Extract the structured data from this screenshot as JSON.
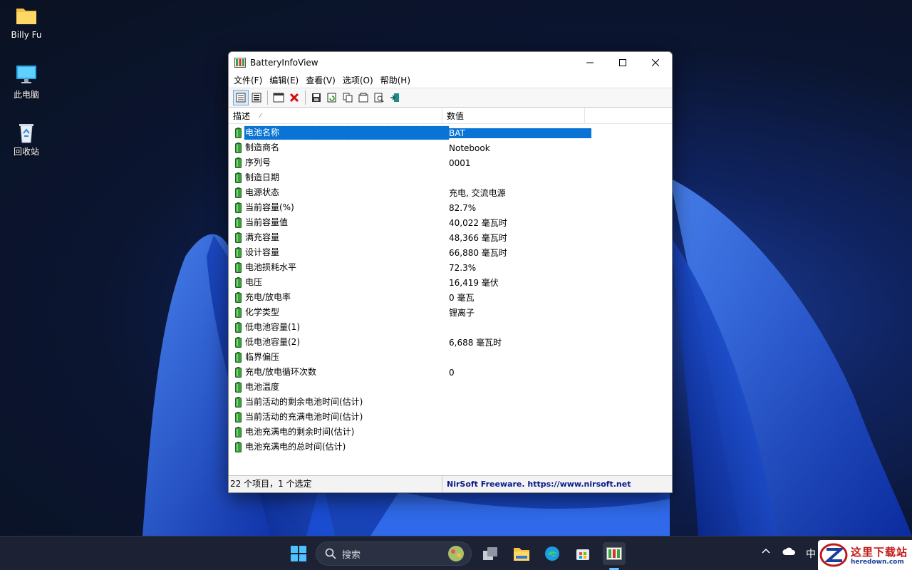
{
  "desktop": {
    "icons": [
      {
        "label": "Billy Fu",
        "icon": "folder-icon"
      },
      {
        "label": "此电脑",
        "icon": "computer-icon"
      },
      {
        "label": "回收站",
        "icon": "recycle-bin-icon"
      }
    ]
  },
  "window": {
    "title": "BatteryInfoView",
    "menu": [
      "文件(F)",
      "编辑(E)",
      "查看(V)",
      "选项(O)",
      "帮助(H)"
    ],
    "columns": {
      "description": "描述",
      "value": "数值"
    },
    "rows": [
      {
        "desc": "电池名称",
        "val": "BAT",
        "selected": true
      },
      {
        "desc": "制造商名",
        "val": "Notebook"
      },
      {
        "desc": "序列号",
        "val": "0001"
      },
      {
        "desc": "制造日期",
        "val": ""
      },
      {
        "desc": "电源状态",
        "val": "充电, 交流电源"
      },
      {
        "desc": "当前容量(%)",
        "val": "82.7%"
      },
      {
        "desc": "当前容量值",
        "val": "40,022 毫瓦时"
      },
      {
        "desc": "满充容量",
        "val": "48,366 毫瓦时"
      },
      {
        "desc": "设计容量",
        "val": "66,880 毫瓦时"
      },
      {
        "desc": "电池损耗水平",
        "val": "72.3%"
      },
      {
        "desc": "电压",
        "val": "16,419 毫伏"
      },
      {
        "desc": "充电/放电率",
        "val": "0 毫瓦"
      },
      {
        "desc": "化学类型",
        "val": "锂离子"
      },
      {
        "desc": "低电池容量(1)",
        "val": ""
      },
      {
        "desc": "低电池容量(2)",
        "val": "6,688 毫瓦时"
      },
      {
        "desc": "临界偏压",
        "val": ""
      },
      {
        "desc": "充电/放电循环次数",
        "val": "0"
      },
      {
        "desc": "电池温度",
        "val": ""
      },
      {
        "desc": "当前活动的剩余电池时间(估计)",
        "val": ""
      },
      {
        "desc": "当前活动的充满电池时间(估计)",
        "val": ""
      },
      {
        "desc": "电池充满电的剩余时间(估计)",
        "val": ""
      },
      {
        "desc": "电池充满电的总时间(估计)",
        "val": ""
      }
    ],
    "status": {
      "count": "22 个项目，1 个选定",
      "credit": "NirSoft Freeware. https://www.nirsoft.net"
    }
  },
  "taskbar": {
    "search_label": "搜索",
    "tray_ime": "中"
  },
  "watermark": {
    "main": "这里下载站",
    "sub": "heredown.com"
  },
  "colors": {
    "selection": "#0a74d6",
    "taskbar": "#1c2233",
    "credit_text": "#0a1a8a"
  }
}
